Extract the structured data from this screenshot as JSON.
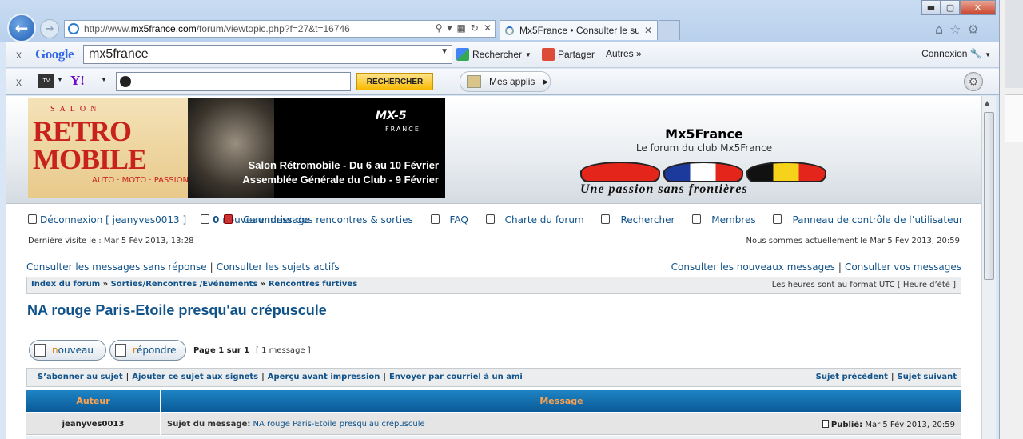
{
  "browser": {
    "url_prefix": "http://www.",
    "url_domain": "mx5france.com",
    "url_path": "/forum/viewtopic.php?f=27&t=16746",
    "tab_title": "Mx5France • Consulter le su...",
    "tab_close": "✕"
  },
  "google_toolbar": {
    "close": "x",
    "logo": "Google",
    "search_value": "mx5france",
    "rechercher": "Rechercher",
    "partager": "Partager",
    "autres": "Autres »",
    "connexion": "Connexion"
  },
  "yahoo_toolbar": {
    "close": "x",
    "tv": "TV",
    "logo": "Y!",
    "search_button": "RECHERCHER",
    "mes_applis": "Mes applis"
  },
  "banner": {
    "salon": "SALON",
    "retro": "RETRO",
    "mobile": "MOBILE",
    "tagline": "AUTO · MOTO · PASSION",
    "mx5": "MX-5",
    "france": "FRANCE",
    "line1": "Salon Rétromobile - Du 6 au 10 Février",
    "line2": "Assemblée Générale du Club - 9 Février"
  },
  "site": {
    "title": "Mx5France",
    "subtitle": "Le forum du club Mx5France",
    "slogan": "Une passion sans frontières"
  },
  "user_nav": {
    "logout": "Déconnexion [ jeanyves0013 ]",
    "new_count": "0",
    "new_label": "nouveau message",
    "calendar": "Calendrier des rencontres & sorties",
    "faq": "FAQ",
    "charter": "Charte du forum",
    "search": "Rechercher",
    "members": "Membres",
    "ucp": "Panneau de contrôle de l’utilisateur"
  },
  "visit": {
    "last": "Dernière visite le : Mar 5 Fév 2013, 13:28",
    "now": "Nous sommes actuellement le Mar 5 Fév 2013, 20:59"
  },
  "quick_links": {
    "unanswered": "Consulter les messages sans réponse",
    "active": "Consulter les sujets actifs",
    "new_posts": "Consulter les nouveaux messages",
    "your_posts": "Consulter vos messages"
  },
  "breadcrumb": {
    "index": "Index du forum",
    "cat": "Sorties/Rencontres /Evénements",
    "forum": "Rencontres furtives",
    "sep": "»",
    "timezone": "Les heures sont au format UTC [ Heure d’été ]"
  },
  "topic": {
    "title": "NA rouge Paris-Etoile presqu'au crépuscule",
    "new_first": "n",
    "new_rest": "ouveau",
    "reply_first": "r",
    "reply_rest": "épondre",
    "page_of": "Page 1 sur 1",
    "count": "[ 1 message ]"
  },
  "actions": {
    "subscribe": "S’abonner au sujet",
    "bookmark": "Ajouter ce sujet aux signets",
    "print": "Aperçu avant impression",
    "email": "Envoyer par courriel à un ami",
    "prev": "Sujet précédent",
    "next": "Sujet suivant"
  },
  "table": {
    "col_author": "Auteur",
    "col_message": "Message"
  },
  "post": {
    "author": "jeanyves0013",
    "subject_label": "Sujet du message:",
    "subject": "NA rouge Paris-Etoile presqu'au crépuscule",
    "published_label": "Publié:",
    "published": "Mar 5 Fév 2013, 20:59"
  }
}
